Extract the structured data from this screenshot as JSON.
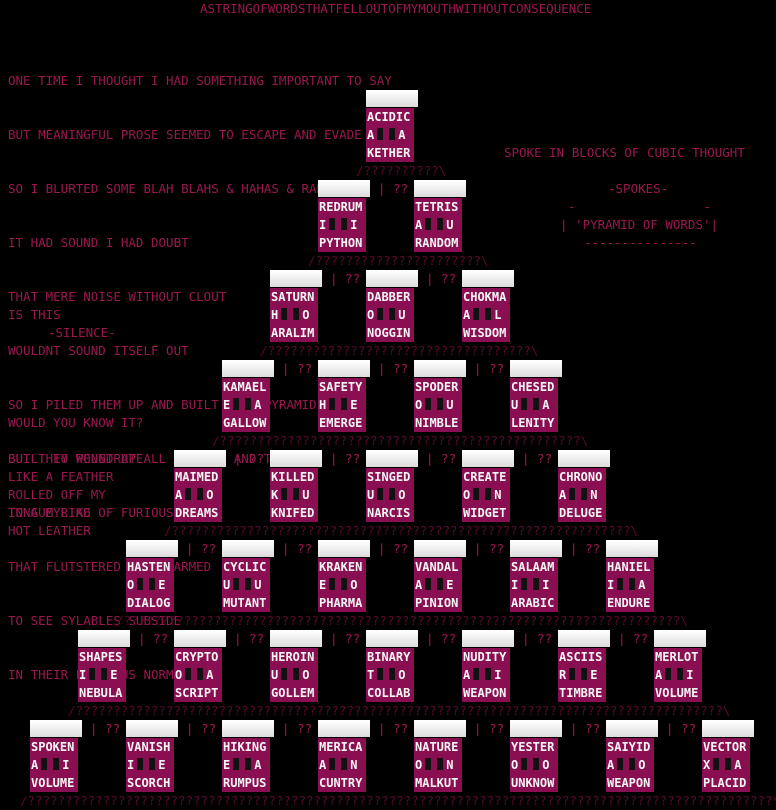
{
  "title": "ASTRINGOFWORDSTHATFELLOUTOFMYMOUTHWITHOUTCONSEQUENCE",
  "poem": [
    "ONE TIME I THOUGHT I HAD SOMETHING IMPORTANT TO SAY",
    "BUT MEANINGFUL PROSE SEEMED TO ESCAPE AND EVADE ME",
    "SO I BLURTED SOME BLAH BLAHS & HAHAS & RARAS",
    "IT HAD SOUND I HAD DOUBT",
    "THAT MERE NOISE WITHOUT CLOUT",
    "WOULDNT SOUND ITSELF OUT",
    "SO I PILED THEM UP AND BUILT UP A PYRAMID",
    "BUT THEY WOUND UP ALL TANGLED AND TORN",
    "IN A MYRIAD OF FURIOUS FORMS",
    "THAT FLUTSTERED AND SWARMED",
    "TO SEE SYLABLES SUBSIDE",
    "IN THEIR PREVIOUS NORM"
  ],
  "side_text": {
    "cubic": "SPOKE IN BLOCKS OF CUBIC THOUGHT",
    "spokes_heading": "-SPOKES-",
    "spokes_dashes": "-                 -",
    "pyramid_label": "| 'PYRAMID OF WORDS'|",
    "spokes_underline": "---------------",
    "is_this": "IS THIS",
    "silence": "-SILENCE-",
    "would_you": "WOULD YOU KNOW IT?",
    "feather": [
      "BUILT TO PENETRATE",
      "LIKE A FEATHER",
      "ROLLED OFF MY",
      "TONGUE LIKE",
      "HOT LEATHER"
    ]
  },
  "rows": [
    {
      "blocks": [
        {
          "top": "ACIDIC",
          "mid": [
            "A",
            "A"
          ],
          "bottom": "KETHER"
        }
      ]
    },
    {
      "blocks": [
        {
          "top": "REDRUM",
          "mid": [
            "I",
            "I"
          ],
          "bottom": "PYTHON"
        },
        {
          "top": "TETRIS",
          "mid": [
            "A",
            "U"
          ],
          "bottom": "RANDOM"
        }
      ]
    },
    {
      "blocks": [
        {
          "top": "SATURN",
          "mid": [
            "H",
            "O"
          ],
          "bottom": "ARALIM"
        },
        {
          "top": "DABBER",
          "mid": [
            "O",
            "U"
          ],
          "bottom": "NOGGIN"
        },
        {
          "top": "CHOKMA",
          "mid": [
            "A",
            "L"
          ],
          "bottom": "WISDOM"
        }
      ]
    },
    {
      "blocks": [
        {
          "top": "KAMAEL",
          "mid": [
            "E",
            "A"
          ],
          "bottom": "GALLOW"
        },
        {
          "top": "SAFETY",
          "mid": [
            "H",
            "E"
          ],
          "bottom": "EMERGE"
        },
        {
          "top": "SPODER",
          "mid": [
            "O",
            "U"
          ],
          "bottom": "NIMBLE"
        },
        {
          "top": "CHESED",
          "mid": [
            "U",
            "A"
          ],
          "bottom": "LENITY"
        }
      ]
    },
    {
      "blocks": [
        {
          "top": "MAIMED",
          "mid": [
            "A",
            "O"
          ],
          "bottom": "DREAMS"
        },
        {
          "top": "KILLED",
          "mid": [
            "K",
            "U"
          ],
          "bottom": "KNIFED"
        },
        {
          "top": "SINGED",
          "mid": [
            "U",
            "O"
          ],
          "bottom": "NARCIS"
        },
        {
          "top": "CREATE",
          "mid": [
            "O",
            "N"
          ],
          "bottom": "WIDGET"
        },
        {
          "top": "CHRONO",
          "mid": [
            "A",
            "N"
          ],
          "bottom": "DELUGE"
        }
      ]
    },
    {
      "blocks": [
        {
          "top": "HASTEN",
          "mid": [
            "O",
            "E"
          ],
          "bottom": "DIALOG"
        },
        {
          "top": "CYCLIC",
          "mid": [
            "U",
            "U"
          ],
          "bottom": "MUTANT"
        },
        {
          "top": "KRAKEN",
          "mid": [
            "E",
            "O"
          ],
          "bottom": "PHARMA"
        },
        {
          "top": "VANDAL",
          "mid": [
            "A",
            "E"
          ],
          "bottom": "PINION"
        },
        {
          "top": "SALAAM",
          "mid": [
            "I",
            "I"
          ],
          "bottom": "ARABIC"
        },
        {
          "top": "HANIEL",
          "mid": [
            "I",
            "A"
          ],
          "bottom": "ENDURE"
        }
      ]
    },
    {
      "blocks": [
        {
          "top": "SHAPES",
          "mid": [
            "I",
            "E"
          ],
          "bottom": "NEBULA"
        },
        {
          "top": "CRYPTO",
          "mid": [
            "O",
            "A"
          ],
          "bottom": "SCRIPT"
        },
        {
          "top": "HEROIN",
          "mid": [
            "U",
            "O"
          ],
          "bottom": "GOLLEM"
        },
        {
          "top": "BINARY",
          "mid": [
            "T",
            "O"
          ],
          "bottom": "COLLAB"
        },
        {
          "top": "NUDITY",
          "mid": [
            "A",
            "I"
          ],
          "bottom": "WEAPON"
        },
        {
          "top": "ASCIIS",
          "mid": [
            "R",
            "E"
          ],
          "bottom": "TIMBRE"
        },
        {
          "top": "MERLOT",
          "mid": [
            "A",
            "I"
          ],
          "bottom": "VOLUME"
        }
      ]
    },
    {
      "blocks": [
        {
          "top": "SPOKEN",
          "mid": [
            "A",
            "I"
          ],
          "bottom": "VOLUME"
        },
        {
          "top": "VANISH",
          "mid": [
            "I",
            "E"
          ],
          "bottom": "SCORCH"
        },
        {
          "top": "HIKING",
          "mid": [
            "E",
            "A"
          ],
          "bottom": "RUMPUS"
        },
        {
          "top": "MERICA",
          "mid": [
            "A",
            "N"
          ],
          "bottom": "CUNTRY"
        },
        {
          "top": "NATURE",
          "mid": [
            "O",
            "N"
          ],
          "bottom": "MALKUT"
        },
        {
          "top": "YESTER",
          "mid": [
            "O",
            "O"
          ],
          "bottom": "UNKNOW"
        },
        {
          "top": "SAIYID",
          "mid": [
            "A",
            "O"
          ],
          "bottom": "WEAPON"
        },
        {
          "top": "VECTOR",
          "mid": [
            "X",
            "A"
          ],
          "bottom": "PLACID"
        }
      ]
    }
  ],
  "filler": "??",
  "colors": {
    "background": "#000000",
    "text": "#9a1750",
    "block": "#8a0f52",
    "block_text": "#f5f5f5"
  }
}
